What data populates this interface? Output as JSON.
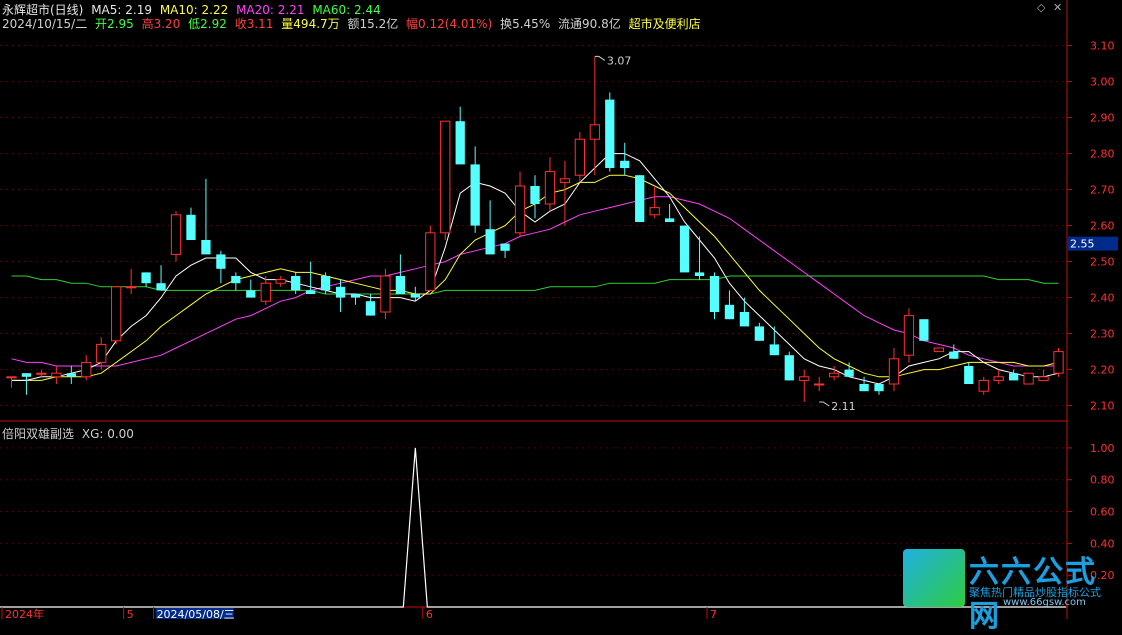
{
  "header": {
    "stock_name": "永辉超市(日线)",
    "ma5": "MA5: 2.19",
    "ma10": "MA10: 2.22",
    "ma20": "MA20: 2.21",
    "ma60": "MA60: 2.44",
    "date": "2024/10/15/二",
    "open": "开2.95",
    "high": "高3.20",
    "low": "低2.92",
    "close": "收3.11",
    "volume": "量494.7万",
    "amount": "额15.2亿",
    "change": "幅0.12(4.01%)",
    "turnover": "换5.45%",
    "float_cap": "流通90.8亿",
    "sector": "超市及便利店"
  },
  "sub_header": {
    "indicator_name": "倍阳双雄副选",
    "xg": "XG: 0.00"
  },
  "colors": {
    "up": "#ff3030",
    "down": "#54ffff",
    "ma5": "#ffffff",
    "ma10": "#ffff30",
    "ma20": "#ff40ff",
    "ma60": "#30d030",
    "axis": "#c01010",
    "axis_text": "#ff3030",
    "signal": "#ffffff"
  },
  "icons": [
    "diamond-icon",
    "close-icon"
  ],
  "logo": {
    "title": "六六公式网",
    "subtitle": "聚焦热门精品炒股指标公式",
    "url": "www.66gsw.com"
  },
  "chart_data": [
    {
      "type": "candlestick",
      "title": "永辉超市(日线)",
      "y_ticks": [
        "3.10",
        "3.00",
        "2.90",
        "2.80",
        "2.70",
        "2.60",
        "2.50",
        "2.40",
        "2.30",
        "2.20",
        "2.10"
      ],
      "ylim": [
        2.06,
        3.16
      ],
      "current_price_label": "2.55",
      "annotations": [
        {
          "text": "3.07",
          "candle": 39,
          "value": 3.07
        },
        {
          "text": "2.11",
          "candle": 54,
          "value": 2.11
        }
      ],
      "x_labels": [
        {
          "text": "2024年",
          "candle": 0
        },
        {
          "text": "5",
          "candle": 8
        },
        {
          "text": "2024/05/08/三",
          "candle": 10
        },
        {
          "text": "6",
          "candle": 28
        },
        {
          "text": "7",
          "candle": 47
        }
      ],
      "candles": [
        [
          2.18,
          2.18,
          2.15,
          2.18
        ],
        [
          2.19,
          2.19,
          2.13,
          2.18
        ],
        [
          2.19,
          2.2,
          2.18,
          2.19
        ],
        [
          2.18,
          2.21,
          2.16,
          2.19
        ],
        [
          2.19,
          2.21,
          2.16,
          2.18
        ],
        [
          2.18,
          2.24,
          2.17,
          2.22
        ],
        [
          2.22,
          2.29,
          2.2,
          2.27
        ],
        [
          2.28,
          2.43,
          2.27,
          2.43
        ],
        [
          2.43,
          2.48,
          2.41,
          2.43
        ],
        [
          2.47,
          2.47,
          2.43,
          2.44
        ],
        [
          2.44,
          2.49,
          2.42,
          2.42
        ],
        [
          2.52,
          2.64,
          2.5,
          2.63
        ],
        [
          2.63,
          2.65,
          2.56,
          2.56
        ],
        [
          2.56,
          2.73,
          2.55,
          2.52
        ],
        [
          2.52,
          2.53,
          2.44,
          2.48
        ],
        [
          2.46,
          2.47,
          2.42,
          2.44
        ],
        [
          2.42,
          2.45,
          2.4,
          2.4
        ],
        [
          2.39,
          2.46,
          2.38,
          2.44
        ],
        [
          2.44,
          2.46,
          2.43,
          2.45
        ],
        [
          2.46,
          2.47,
          2.41,
          2.42
        ],
        [
          2.42,
          2.5,
          2.41,
          2.41
        ],
        [
          2.46,
          2.47,
          2.41,
          2.42
        ],
        [
          2.43,
          2.45,
          2.36,
          2.4
        ],
        [
          2.41,
          2.41,
          2.38,
          2.4
        ],
        [
          2.39,
          2.41,
          2.35,
          2.35
        ],
        [
          2.36,
          2.48,
          2.34,
          2.46
        ],
        [
          2.46,
          2.52,
          2.42,
          2.41
        ],
        [
          2.41,
          2.43,
          2.39,
          2.4
        ],
        [
          2.42,
          2.6,
          2.42,
          2.58
        ],
        [
          2.58,
          2.89,
          2.56,
          2.89
        ],
        [
          2.89,
          2.93,
          2.79,
          2.77
        ],
        [
          2.77,
          2.82,
          2.58,
          2.6
        ],
        [
          2.59,
          2.67,
          2.52,
          2.52
        ],
        [
          2.55,
          2.55,
          2.51,
          2.53
        ],
        [
          2.58,
          2.75,
          2.57,
          2.71
        ],
        [
          2.71,
          2.74,
          2.62,
          2.66
        ],
        [
          2.66,
          2.79,
          2.64,
          2.75
        ],
        [
          2.72,
          2.78,
          2.6,
          2.73
        ],
        [
          2.74,
          2.86,
          2.72,
          2.84
        ],
        [
          2.84,
          3.07,
          2.74,
          2.88
        ],
        [
          2.95,
          2.97,
          2.75,
          2.76
        ],
        [
          2.78,
          2.83,
          2.74,
          2.76
        ],
        [
          2.74,
          2.74,
          2.62,
          2.61
        ],
        [
          2.63,
          2.71,
          2.62,
          2.65
        ],
        [
          2.62,
          2.66,
          2.61,
          2.61
        ],
        [
          2.6,
          2.6,
          2.47,
          2.47
        ],
        [
          2.47,
          2.57,
          2.45,
          2.46
        ],
        [
          2.46,
          2.47,
          2.34,
          2.36
        ],
        [
          2.38,
          2.42,
          2.34,
          2.34
        ],
        [
          2.36,
          2.4,
          2.32,
          2.32
        ],
        [
          2.32,
          2.33,
          2.28,
          2.28
        ],
        [
          2.27,
          2.32,
          2.24,
          2.24
        ],
        [
          2.24,
          2.25,
          2.17,
          2.17
        ],
        [
          2.17,
          2.2,
          2.11,
          2.18
        ],
        [
          2.16,
          2.18,
          2.14,
          2.16
        ],
        [
          2.18,
          2.21,
          2.17,
          2.19
        ],
        [
          2.2,
          2.22,
          2.18,
          2.18
        ],
        [
          2.16,
          2.18,
          2.14,
          2.14
        ],
        [
          2.16,
          2.16,
          2.13,
          2.14
        ],
        [
          2.16,
          2.26,
          2.14,
          2.23
        ],
        [
          2.24,
          2.37,
          2.22,
          2.35
        ],
        [
          2.34,
          2.34,
          2.28,
          2.28
        ],
        [
          2.25,
          2.26,
          2.25,
          2.26
        ],
        [
          2.25,
          2.27,
          2.23,
          2.23
        ],
        [
          2.21,
          2.22,
          2.16,
          2.16
        ],
        [
          2.14,
          2.18,
          2.13,
          2.17
        ],
        [
          2.17,
          2.2,
          2.16,
          2.18
        ],
        [
          2.19,
          2.2,
          2.17,
          2.17
        ],
        [
          2.16,
          2.19,
          2.16,
          2.19
        ],
        [
          2.17,
          2.2,
          2.17,
          2.18
        ],
        [
          2.19,
          2.26,
          2.18,
          2.25
        ]
      ],
      "ma5": [
        2.17,
        2.17,
        2.18,
        2.18,
        2.19,
        2.2,
        2.22,
        2.28,
        2.32,
        2.35,
        2.4,
        2.46,
        2.49,
        2.51,
        2.51,
        2.51,
        2.47,
        2.45,
        2.45,
        2.44,
        2.43,
        2.42,
        2.41,
        2.41,
        2.4,
        2.4,
        2.4,
        2.39,
        2.42,
        2.54,
        2.69,
        2.72,
        2.71,
        2.69,
        2.64,
        2.61,
        2.64,
        2.66,
        2.72,
        2.76,
        2.8,
        2.8,
        2.78,
        2.73,
        2.68,
        2.61,
        2.56,
        2.51,
        2.44,
        2.39,
        2.35,
        2.31,
        2.27,
        2.23,
        2.21,
        2.2,
        2.18,
        2.17,
        2.16,
        2.18,
        2.21,
        2.22,
        2.23,
        2.25,
        2.25,
        2.22,
        2.2,
        2.19,
        2.18,
        2.18,
        2.19
      ],
      "ma10": [
        2.17,
        2.17,
        2.17,
        2.18,
        2.18,
        2.18,
        2.19,
        2.22,
        2.25,
        2.28,
        2.32,
        2.35,
        2.38,
        2.41,
        2.43,
        2.45,
        2.46,
        2.47,
        2.48,
        2.47,
        2.47,
        2.46,
        2.45,
        2.44,
        2.43,
        2.42,
        2.42,
        2.41,
        2.41,
        2.45,
        2.52,
        2.56,
        2.58,
        2.6,
        2.64,
        2.66,
        2.69,
        2.7,
        2.72,
        2.72,
        2.74,
        2.74,
        2.73,
        2.71,
        2.69,
        2.65,
        2.61,
        2.57,
        2.52,
        2.47,
        2.42,
        2.38,
        2.34,
        2.3,
        2.26,
        2.23,
        2.21,
        2.19,
        2.18,
        2.18,
        2.19,
        2.2,
        2.2,
        2.21,
        2.22,
        2.22,
        2.22,
        2.22,
        2.21,
        2.21,
        2.22
      ],
      "ma20": [
        2.23,
        2.22,
        2.22,
        2.21,
        2.21,
        2.21,
        2.21,
        2.21,
        2.22,
        2.23,
        2.24,
        2.26,
        2.28,
        2.3,
        2.32,
        2.34,
        2.35,
        2.37,
        2.39,
        2.4,
        2.42,
        2.43,
        2.44,
        2.45,
        2.46,
        2.46,
        2.47,
        2.48,
        2.49,
        2.5,
        2.52,
        2.53,
        2.54,
        2.55,
        2.57,
        2.58,
        2.59,
        2.61,
        2.63,
        2.64,
        2.65,
        2.66,
        2.67,
        2.68,
        2.68,
        2.67,
        2.66,
        2.64,
        2.62,
        2.59,
        2.56,
        2.53,
        2.5,
        2.47,
        2.44,
        2.41,
        2.38,
        2.35,
        2.33,
        2.31,
        2.3,
        2.28,
        2.27,
        2.26,
        2.24,
        2.23,
        2.22,
        2.21,
        2.21,
        2.21,
        2.21
      ],
      "ma60": [
        2.46,
        2.46,
        2.45,
        2.45,
        2.44,
        2.44,
        2.43,
        2.43,
        2.43,
        2.43,
        2.42,
        2.42,
        2.42,
        2.42,
        2.42,
        2.42,
        2.42,
        2.42,
        2.42,
        2.42,
        2.42,
        2.41,
        2.41,
        2.41,
        2.41,
        2.41,
        2.41,
        2.41,
        2.41,
        2.42,
        2.42,
        2.42,
        2.42,
        2.42,
        2.42,
        2.42,
        2.43,
        2.43,
        2.43,
        2.43,
        2.44,
        2.44,
        2.44,
        2.44,
        2.45,
        2.45,
        2.45,
        2.45,
        2.46,
        2.46,
        2.46,
        2.46,
        2.46,
        2.46,
        2.46,
        2.46,
        2.46,
        2.46,
        2.46,
        2.46,
        2.46,
        2.46,
        2.46,
        2.46,
        2.46,
        2.46,
        2.45,
        2.45,
        2.45,
        2.44,
        2.44
      ]
    },
    {
      "type": "line",
      "title": "倍阳双雄副选",
      "series": [
        {
          "name": "XG",
          "values_nonzero": [
            {
              "candle": 27,
              "value": 1.0
            }
          ]
        }
      ],
      "y_ticks": [
        "1.00",
        "0.80",
        "0.60",
        "0.40",
        "0.20"
      ],
      "ylim": [
        0,
        1.1
      ]
    }
  ]
}
